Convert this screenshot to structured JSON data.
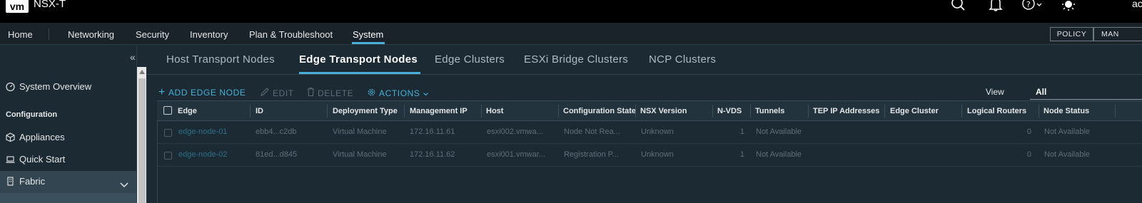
{
  "header": {
    "logo": "vm",
    "title": "NSX-T",
    "user": "ac",
    "icons": [
      "search-icon",
      "bell-icon",
      "help-icon",
      "sun-icon"
    ]
  },
  "nav": {
    "items": [
      "Home",
      "Networking",
      "Security",
      "Inventory",
      "Plan & Troubleshoot",
      "System"
    ],
    "active": "System",
    "mode_buttons": [
      "POLICY",
      "MAN"
    ]
  },
  "sidebar": {
    "items": [
      {
        "label": "System Overview",
        "icon": "overview-icon"
      },
      {
        "label": "Appliances",
        "icon": "cube-icon"
      },
      {
        "label": "Quick Start",
        "icon": "laptop-icon"
      },
      {
        "label": "Fabric",
        "icon": "building-icon"
      }
    ],
    "section": "Configuration"
  },
  "tabs": [
    "Host Transport Nodes",
    "Edge Transport Nodes",
    "Edge Clusters",
    "ESXi Bridge Clusters",
    "NCP Clusters"
  ],
  "active_tab": "Edge Transport Nodes",
  "toolbar": {
    "add": "ADD EDGE NODE",
    "edit": "EDIT",
    "delete": "DELETE",
    "actions": "ACTIONS",
    "view_label": "View",
    "view_value": "All"
  },
  "table": {
    "columns": [
      "Edge",
      "ID",
      "Deployment Type",
      "Management IP",
      "Host",
      "Configuration State",
      "NSX Version",
      "N-VDS",
      "Tunnels",
      "TEP IP Addresses",
      "Edge Cluster",
      "Logical Routers",
      "Node Status"
    ],
    "rows": [
      [
        "edge-node-01",
        "ebb4...c2db",
        "Virtual Machine",
        "172.16.11.61",
        "esxi002.vmwa...",
        "Node Not Rea...",
        "Unknown",
        "1",
        "Not Available",
        "",
        "",
        "0",
        "Not Available"
      ],
      [
        "edge-node-02",
        "81ed...d845",
        "Virtual Machine",
        "172.16.11.62",
        "esxi001.vmwar...",
        "Registration P...",
        "Unknown",
        "1",
        "Not Available",
        "",
        "",
        "0",
        "Not Available"
      ]
    ]
  }
}
